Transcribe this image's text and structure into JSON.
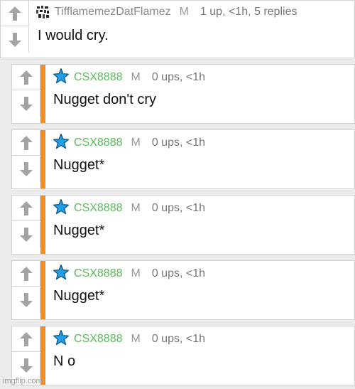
{
  "top_comment": {
    "username": "TifflamemezDatFlamez",
    "badge": "M",
    "stats": "1 up, <1h, 5 replies",
    "text": "I would cry."
  },
  "replies": [
    {
      "username": "CSX8888",
      "badge": "M",
      "stats": "0 ups, <1h",
      "text": "Nugget don't cry"
    },
    {
      "username": "CSX8888",
      "badge": "M",
      "stats": "0 ups, <1h",
      "text": "Nugget*"
    },
    {
      "username": "CSX8888",
      "badge": "M",
      "stats": "0 ups, <1h",
      "text": "Nugget*"
    },
    {
      "username": "CSX8888",
      "badge": "M",
      "stats": "0 ups, <1h",
      "text": "Nugget*"
    },
    {
      "username": "CSX8888",
      "badge": "M",
      "stats": "0 ups, <1h",
      "text": "N o"
    }
  ],
  "colors": {
    "thread_bar": "#f68b1f",
    "reply_username": "#5cb85c",
    "star_icon": "#1e9fe8"
  },
  "icons": {
    "upvote": "arrow-up-icon",
    "downvote": "arrow-down-icon",
    "reply_avatar": "star-icon",
    "top_avatar": "pixel-avatar"
  },
  "watermark": "imgflip.com"
}
